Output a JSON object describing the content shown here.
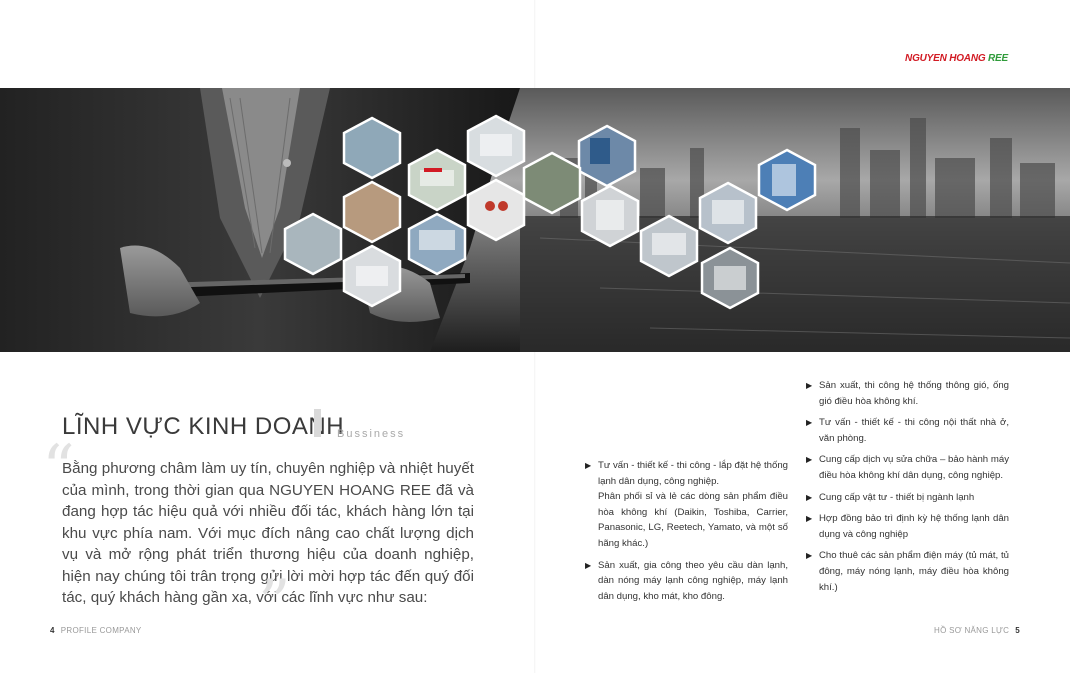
{
  "brand": {
    "part1": "NGUYEN HOANG",
    "part2": "REE"
  },
  "banner": {
    "hexagons": [
      "technicians-icon",
      "storefront-icon",
      "industrial-unit-icon",
      "technician-repair-icon",
      "ceiling-room-icon",
      "showroom-icon",
      "gauges-icon",
      "workers-icon",
      "outdoor-unit-icon",
      "building-icon",
      "factory-icon",
      "installer-icon",
      "radiator-icon",
      "duct-icon",
      "cassette-icon",
      "truck-icon"
    ]
  },
  "section": {
    "title": "LĨNH VỰC KINH DOANH",
    "subtitle": "Bussiness"
  },
  "intro": "Bằng phương châm làm uy tín, chuyên nghiệp và nhiệt huyết của mình, trong thời gian qua NGUYEN HOANG REE đã và đang hợp tác hiệu quả với nhiều đối tác, khách hàng lớn tại khu vực phía nam. Với mục đích nâng cao chất lượng dịch vụ và mở rộng phát triển thương hiệu của doanh nghiệp, hiện nay chúng tôi trân trọng gửi lời mời hợp tác đến quý đối tác, quý khách hàng gần xa, với các lĩnh vực như sau:",
  "services_col1": [
    {
      "text": "Tư vấn - thiết kế - thi công - lắp đặt hệ thống lạnh dân dụng, công nghiệp.",
      "sub": "Phân phối sỉ và lẻ các dòng sản phẩm điều hòa không khí (Daikin, Toshiba, Carrier, Panasonic, LG, Reetech, Yamato, và một số hãng khác.)"
    },
    {
      "text": "Sản xuất, gia công theo yêu cầu dàn lạnh, dàn nóng máy lạnh công nghiệp, máy lạnh dân dụng, kho mát, kho đông.",
      "sub": ""
    }
  ],
  "services_col2": [
    "Sản xuất, thi công hệ thống thông gió, ống gió điều hòa không khí.",
    "Tư vấn - thiết kế - thi công nội thất nhà ở, văn phòng.",
    "Cung cấp dịch vụ sửa chữa – bảo hành máy điều hòa không khí dân dụng, công nghiệp.",
    "Cung cấp vật tư - thiết bị ngành lạnh",
    "Hợp đồng bảo trì định kỳ hệ thống lạnh dân dụng và công nghiệp",
    "Cho thuê các sản phẩm điện máy (tủ mát, tủ đông, máy nóng lạnh, máy điều hòa không khí.)"
  ],
  "footer": {
    "left_page": "4",
    "left_label": "PROFILE COMPANY",
    "right_label": "HỒ SƠ NĂNG LỰC",
    "right_page": "5"
  },
  "colors": {
    "brand_red": "#d21b24",
    "brand_green": "#2f9b3a"
  }
}
